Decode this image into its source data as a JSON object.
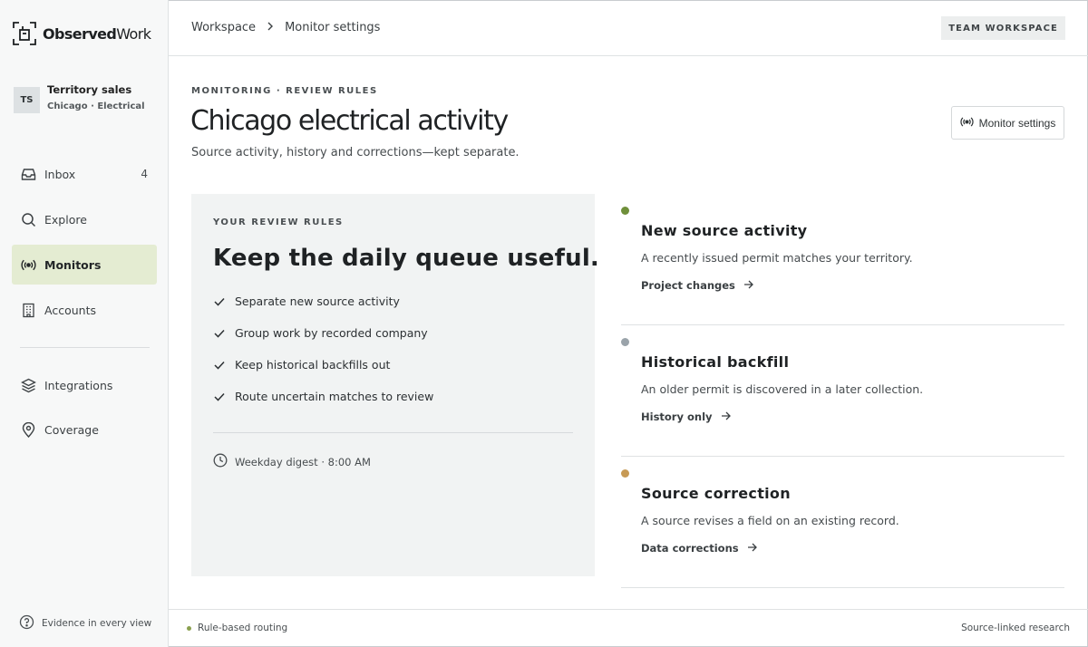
{
  "brand": {
    "name_bold": "Observed",
    "name_light": "Work"
  },
  "team": {
    "initials": "TS",
    "name": "Territory sales",
    "sub": "Chicago · Electrical"
  },
  "nav": [
    {
      "label": "Inbox",
      "icon": "inbox-icon",
      "count": "4"
    },
    {
      "label": "Explore",
      "icon": "search-icon"
    },
    {
      "label": "Monitors",
      "icon": "broadcast-icon",
      "active": true
    },
    {
      "label": "Accounts",
      "icon": "building-icon"
    },
    {
      "label": "Integrations",
      "icon": "layers-icon"
    },
    {
      "label": "Coverage",
      "icon": "map-pin-icon"
    }
  ],
  "sidebar_footer": "Evidence in every view",
  "breadcrumb": [
    "Workspace",
    "Monitor settings"
  ],
  "workspace_badge": "TEAM WORKSPACE",
  "header": {
    "eyebrow": "MONITORING · REVIEW RULES",
    "title": "Chicago electrical activity",
    "subtitle": "Source activity, history and corrections—kept separate.",
    "button": "Monitor settings"
  },
  "rules": {
    "eyebrow": "YOUR REVIEW RULES",
    "title": "Keep the daily queue useful.",
    "items": [
      "Separate new source activity",
      "Group work by recorded company",
      "Keep historical backfills out",
      "Route uncertain matches to review"
    ],
    "digest": "Weekday digest · 8:00 AM"
  },
  "events": [
    {
      "title": "New source activity",
      "desc": "A recently issued permit matches your territory.",
      "link": "Project changes",
      "color": "#6f8f3a"
    },
    {
      "title": "Historical backfill",
      "desc": "An older permit is discovered in a later collection.",
      "link": "History only",
      "color": "#9aa3aa"
    },
    {
      "title": "Source correction",
      "desc": "A source revises a field on an existing record.",
      "link": "Data corrections",
      "color": "#c79a55"
    }
  ],
  "footer": {
    "left": "Rule-based routing",
    "right": "Source-linked research",
    "dot_color": "#8aa04e"
  },
  "colors": {
    "active_nav_bg": "#e4ecd2"
  }
}
